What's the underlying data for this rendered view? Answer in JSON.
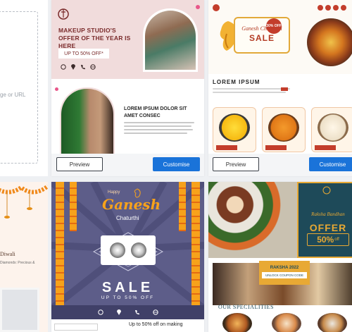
{
  "left_column": {
    "url_hint": "ge or URL",
    "diwali_title": "Diwali",
    "diwali_sub": "Diamonds: Precious &"
  },
  "cards": [
    {
      "id": "makeup",
      "headline": "MAKEUP STUDIO'S OFFER OF THE YEAR IS HERE",
      "offer": "UP TO 50% OFF*",
      "subheading": "LOREM IPSUM DOLOR SIT AMET CONSEC",
      "preview_label": "Preview",
      "customise_label": "Customise"
    },
    {
      "id": "ganesh-food",
      "banner_line1": "Ganesh Chaturthi",
      "banner_line2": "SALE",
      "badge": "30% OFF",
      "heading": "LOREM IPSUM",
      "preview_label": "Preview",
      "customise_label": "Customise"
    },
    {
      "id": "ganesh-sale",
      "happy": "Happy",
      "ganesh": "Ganesh",
      "chaturthi": "Chaturthi",
      "sale": "SALE",
      "upto": "UP TO 50% OFF",
      "footer_text": "Up to 50% off on making"
    },
    {
      "id": "raksha",
      "script_title": "Raksha Bandhan",
      "offer": "OFFER",
      "percent": "50%",
      "percent_suffix": "off",
      "raksha_year": "RAKSHA 2022",
      "coupon": "UNLOCK COUPON CODE",
      "specialities": "OUR SPECIALITIES"
    }
  ],
  "colors": {
    "customise": "#1a73d9",
    "makeup_pink": "#f3dede",
    "makeup_maroon": "#7a2b2b",
    "ganesh_purple": "#5b5b86",
    "ganesh_orange": "#f7a21b",
    "raksha_teal": "#1e4a59",
    "raksha_gold": "#e8a934"
  }
}
